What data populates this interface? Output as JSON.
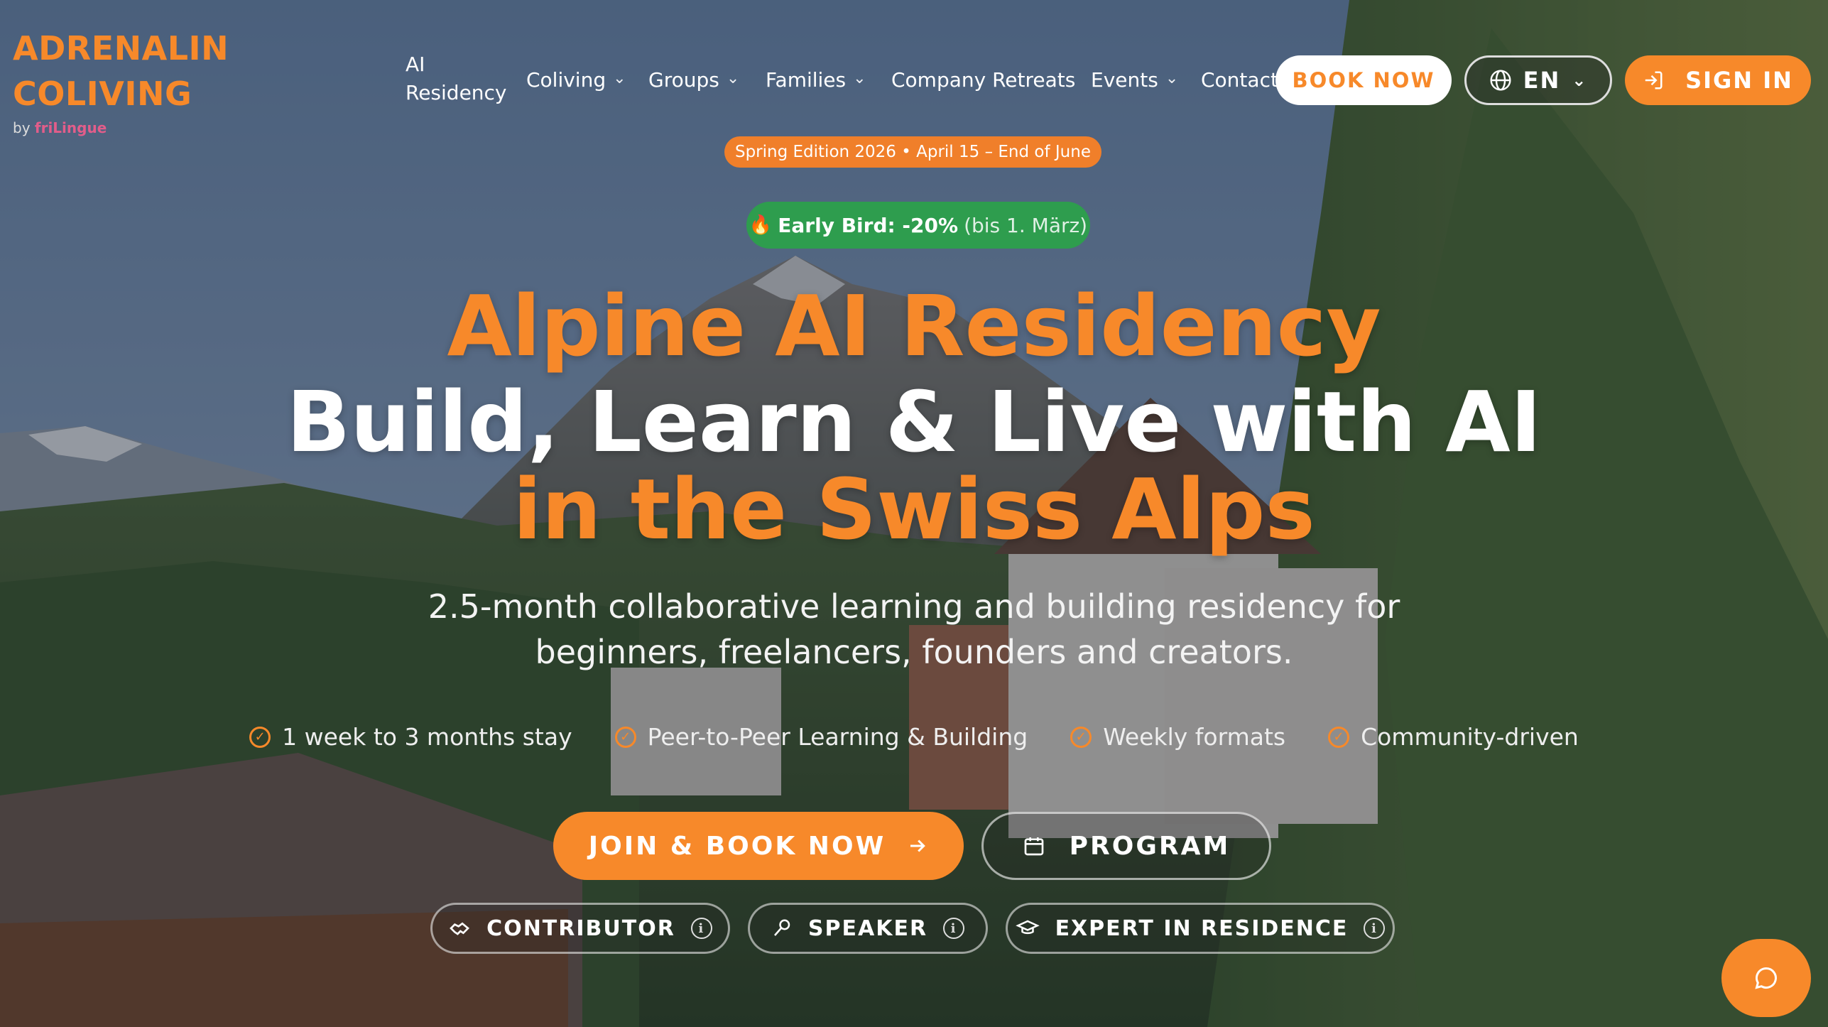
{
  "logo": {
    "line1": "ADRENALIN",
    "line2": "COLIVING",
    "by_prefix": "by",
    "by_brand": "friLingue"
  },
  "nav": {
    "ai_residency_line1": "AI",
    "ai_residency_line2": "Residency",
    "coliving": "Coliving",
    "groups": "Groups",
    "families": "Families",
    "company_retreats": "Company Retreats",
    "events": "Events",
    "contact": "Contact",
    "book_now": "BOOK NOW",
    "language": "EN",
    "sign_in": "SIGN IN"
  },
  "hero": {
    "edition_badge": "Spring Edition 2026 • April 15 – End of June",
    "early_bird_strong": "Early Bird: -20%",
    "early_bird_rest": "(bis 1. März)",
    "title_line1": "Alpine AI Residency",
    "title_line2": "Build, Learn & Live with AI",
    "title_line3": "in the Swiss Alps",
    "subtitle_line1": "2.5-month collaborative learning and building residency for",
    "subtitle_line2": "beginners, freelancers, founders and creators.",
    "features": [
      "1 week to 3 months stay",
      "Peer-to-Peer Learning & Building",
      "Weekly formats",
      "Community-driven"
    ],
    "cta_primary": "JOIN & BOOK NOW",
    "cta_secondary": "PROGRAM",
    "roles": [
      "CONTRIBUTOR",
      "SPEAKER",
      "EXPERT IN RESIDENCE"
    ]
  },
  "icons": {
    "chevron": "chevron-down-icon",
    "globe": "globe-icon",
    "sign_in": "sign-in-icon",
    "fire": "fire-icon",
    "check": "check-circle-icon",
    "arrow": "arrow-right-icon",
    "calendar": "calendar-icon",
    "handshake": "handshake-icon",
    "mic": "microphone-icon",
    "graduation": "graduation-cap-icon",
    "info": "info-icon",
    "chat": "chat-icon"
  },
  "colors": {
    "accent": "#f7892a",
    "early_bird_green": "#2e9d4e",
    "white": "#ffffff"
  }
}
